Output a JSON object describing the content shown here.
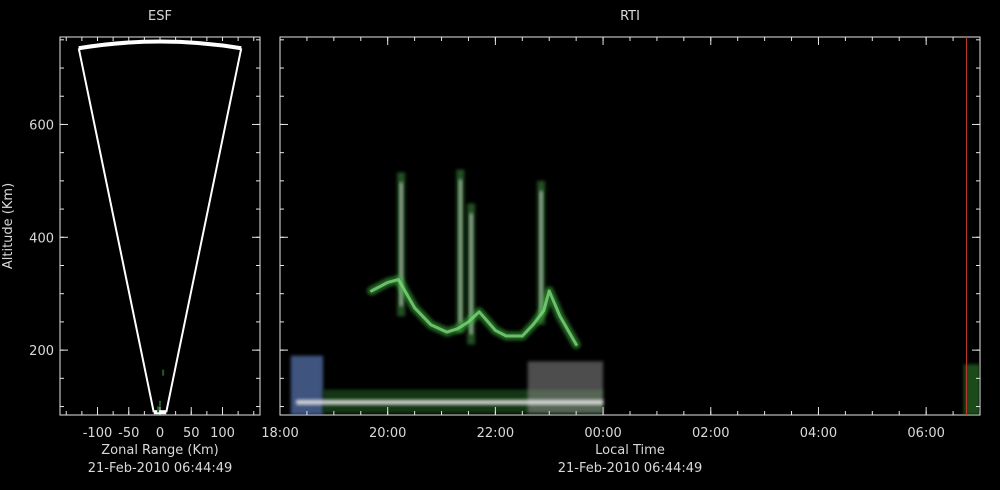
{
  "chart_data": [
    {
      "type": "scatter",
      "title": "ESF",
      "xlabel": "Zonal Range (Km)",
      "ylabel": "Altitude (Km)",
      "caption": "21-Feb-2010 06:44:49",
      "xlim": [
        -160,
        160
      ],
      "ylim": [
        85,
        755
      ],
      "xticks": [
        -100,
        -50,
        0,
        50,
        100
      ],
      "xtick_labels": [
        "-100",
        "-50",
        "0",
        "50",
        "100"
      ],
      "yticks": [
        200,
        400,
        600
      ],
      "ytick_labels": [
        "200",
        "400",
        "600"
      ],
      "beam_outline": {
        "apex_altitude": 90,
        "apex_half_width": 10,
        "top_altitude": 735,
        "top_half_width": 130,
        "top_arc_peak_altitude": 747
      },
      "echo_points": [
        [
          0,
          105
        ],
        [
          5,
          160
        ],
        [
          -3,
          95
        ]
      ],
      "colors": {
        "outline": "#ffffff",
        "echo": "#1f5c1f"
      }
    },
    {
      "type": "heatmap",
      "title": "RTI",
      "xlabel": "Local Time",
      "caption": "21-Feb-2010 06:44:49",
      "xlim": [
        18.0,
        31.0
      ],
      "ylim": [
        85,
        755
      ],
      "xticks": [
        18,
        20,
        22,
        24,
        26,
        28,
        30
      ],
      "xtick_labels": [
        "18:00",
        "20:00",
        "22:00",
        "00:00",
        "02:00",
        "04:00",
        "06:00"
      ],
      "yticks": [
        200,
        400,
        600
      ],
      "ytick_labels": [
        "200",
        "400",
        "600"
      ],
      "current_time_marker": 30.75,
      "colors": {
        "marker": "#c0392b",
        "echo_green": "#3cb33c",
        "echo_white": "#e8e8e8",
        "blue_patch": "#5a78b4"
      },
      "echo_trace": [
        [
          19.7,
          305
        ],
        [
          20.0,
          320
        ],
        [
          20.2,
          325
        ],
        [
          20.5,
          275
        ],
        [
          20.8,
          245
        ],
        [
          21.1,
          232
        ],
        [
          21.3,
          238
        ],
        [
          21.5,
          250
        ],
        [
          21.7,
          268
        ],
        [
          22.0,
          235
        ],
        [
          22.2,
          225
        ],
        [
          22.5,
          225
        ],
        [
          22.7,
          245
        ],
        [
          22.9,
          270
        ],
        [
          23.0,
          305
        ],
        [
          23.2,
          260
        ],
        [
          23.5,
          210
        ]
      ],
      "plumes": [
        {
          "time": 20.25,
          "alt_min": 260,
          "alt_max": 515
        },
        {
          "time": 21.35,
          "alt_min": 230,
          "alt_max": 520
        },
        {
          "time": 21.55,
          "alt_min": 210,
          "alt_max": 460
        },
        {
          "time": 22.85,
          "alt_min": 245,
          "alt_max": 500
        }
      ],
      "bottom_echoes": [
        {
          "t_start": 18.2,
          "t_end": 18.8,
          "alt_min": 85,
          "alt_max": 190
        },
        {
          "t_start": 18.8,
          "t_end": 24.0,
          "alt_min": 88,
          "alt_max": 130
        },
        {
          "t_start": 22.6,
          "t_end": 24.0,
          "alt_min": 88,
          "alt_max": 180
        },
        {
          "t_start": 30.7,
          "t_end": 31.0,
          "alt_min": 85,
          "alt_max": 175
        }
      ]
    }
  ]
}
